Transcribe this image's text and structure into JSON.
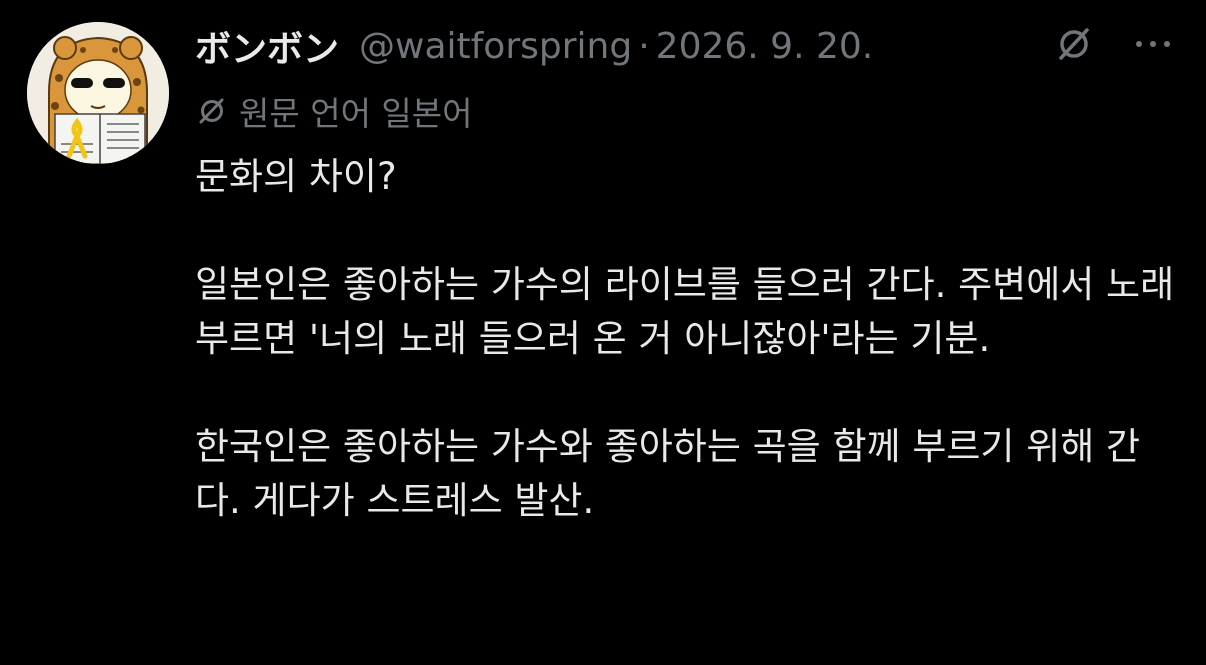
{
  "post": {
    "author": {
      "display_name": "ボンボン",
      "handle": "@waitforspring",
      "avatar_icon": "cartoon-avatar-icon"
    },
    "separator": "·",
    "date": "2026. 9. 20.",
    "actions": {
      "grok_icon": "grok-icon",
      "more_icon": "more-options-icon"
    },
    "translation_note": {
      "icon": "grok-translate-icon",
      "text": "원문 언어 일본어"
    },
    "body": {
      "line1": "문화의 차이?",
      "para2": "일본인은 좋아하는 가수의 라이브를 들으러 간다. 주변에서 노래 부르면 '너의 노래 들으러 온 거 아니잖아'라는 기분.",
      "para3": "한국인은 좋아하는 가수와 좋아하는 곡을 함께 부르기 위해 간다. 게다가 스트레스 발산."
    }
  },
  "colors": {
    "background": "#000000",
    "primary_text": "#e7e9ea",
    "secondary_text": "#71767b"
  }
}
